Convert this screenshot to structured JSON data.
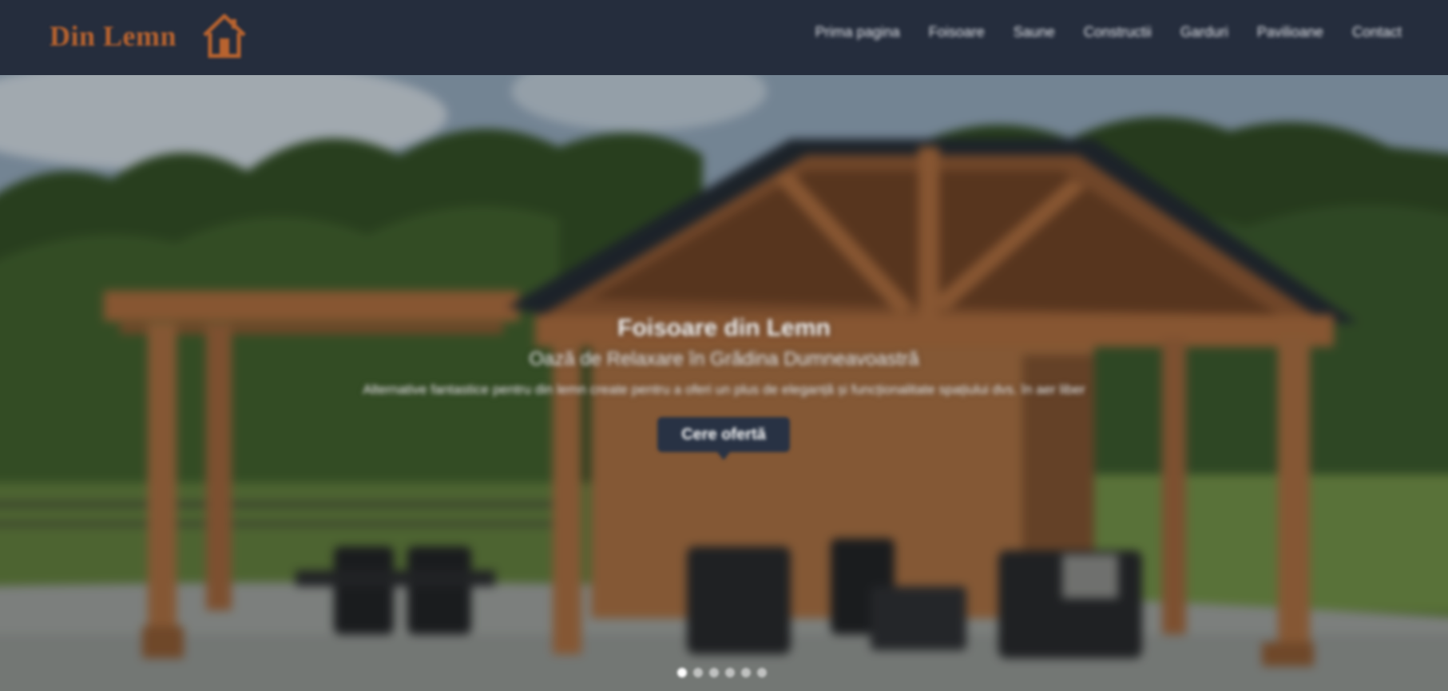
{
  "header": {
    "logo_text": "Din Lemn",
    "logo_color": "#b8632f",
    "background": "#252d3d",
    "nav": [
      {
        "label": "Prima pagina"
      },
      {
        "label": "Foisoare"
      },
      {
        "label": "Saune"
      },
      {
        "label": "Constructii"
      },
      {
        "label": "Garduri"
      },
      {
        "label": "Pavilioane"
      },
      {
        "label": "Contact"
      }
    ]
  },
  "hero": {
    "title": "Foisoare din Lemn",
    "subtitle": "Oază de Relaxare în Grădina Dumneavoastră",
    "description": "Alternative fantastice pentru din lemn create pentru a oferi un plus de eleganță și funcționalitate spațiului dvs. în aer liber",
    "cta_label": "Cere ofertă",
    "cta_color": "#283244",
    "slide_count": 6,
    "active_slide": 1
  }
}
